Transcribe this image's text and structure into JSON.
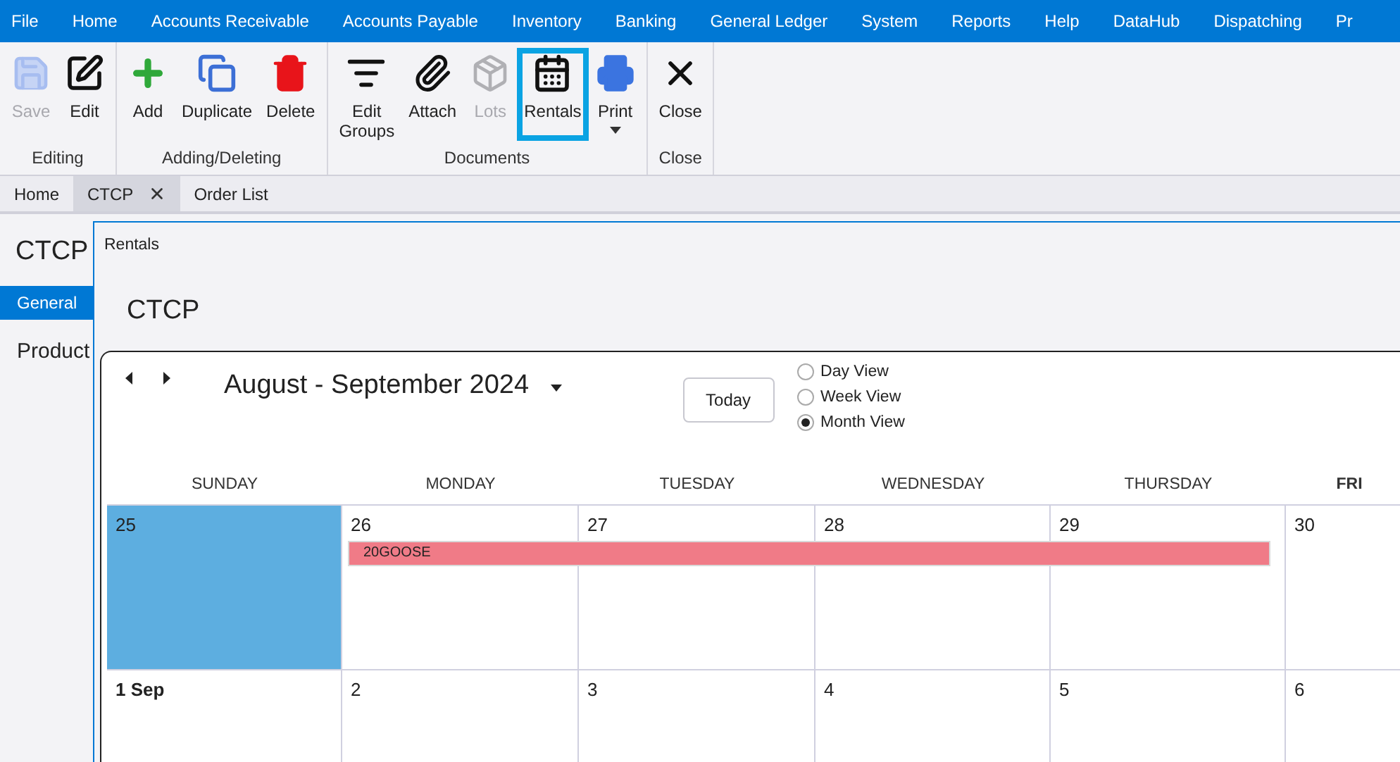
{
  "menu_bar": {
    "items": [
      "File",
      "Home",
      "Accounts Receivable",
      "Accounts Payable",
      "Inventory",
      "Banking",
      "General Ledger",
      "System",
      "Reports",
      "Help",
      "DataHub",
      "Dispatching",
      "Pr"
    ]
  },
  "ribbon": {
    "groups": [
      {
        "label": "Editing",
        "buttons": [
          {
            "label": "Save",
            "disabled": true,
            "selected": false,
            "dropdown": false
          },
          {
            "label": "Edit",
            "disabled": false,
            "selected": false,
            "dropdown": false
          }
        ]
      },
      {
        "label": "Adding/Deleting",
        "buttons": [
          {
            "label": "Add",
            "disabled": false,
            "selected": false,
            "dropdown": false
          },
          {
            "label": "Duplicate",
            "disabled": false,
            "selected": false,
            "dropdown": false
          },
          {
            "label": "Delete",
            "disabled": false,
            "selected": false,
            "dropdown": false
          }
        ]
      },
      {
        "label": "Documents",
        "buttons": [
          {
            "label": "Edit\nGroups",
            "disabled": false,
            "selected": false,
            "dropdown": false
          },
          {
            "label": "Attach",
            "disabled": false,
            "selected": false,
            "dropdown": false
          },
          {
            "label": "Lots",
            "disabled": true,
            "selected": false,
            "dropdown": false
          },
          {
            "label": "Rentals",
            "disabled": false,
            "selected": true,
            "dropdown": false
          },
          {
            "label": "Print",
            "disabled": false,
            "selected": false,
            "dropdown": true
          }
        ]
      },
      {
        "label": "Close",
        "buttons": [
          {
            "label": "Close",
            "disabled": false,
            "selected": false,
            "dropdown": false
          }
        ]
      }
    ]
  },
  "document_tabs": [
    {
      "label": "Home",
      "selected": false,
      "closable": false
    },
    {
      "label": "CTCP",
      "selected": true,
      "closable": true
    },
    {
      "label": "Order List",
      "selected": false,
      "closable": false
    }
  ],
  "side_panel": {
    "title": "CTCP",
    "items": [
      {
        "label": "General",
        "selected": true
      },
      {
        "label": "Product",
        "selected": false
      }
    ]
  },
  "rentals_dialog": {
    "title": "Rentals",
    "heading": "CTCP",
    "calendar": {
      "range_title": "August - September 2024",
      "today_button": "Today",
      "views": [
        {
          "label": "Day View",
          "selected": false
        },
        {
          "label": "Week View",
          "selected": false
        },
        {
          "label": "Month View",
          "selected": true
        }
      ],
      "day_headers": [
        {
          "label": "SUNDAY",
          "bold": false
        },
        {
          "label": "MONDAY",
          "bold": false
        },
        {
          "label": "TUESDAY",
          "bold": false
        },
        {
          "label": "WEDNESDAY",
          "bold": false
        },
        {
          "label": "THURSDAY",
          "bold": false
        },
        {
          "label": "FRI",
          "bold": true
        }
      ],
      "weeks": [
        {
          "days": [
            {
              "label": "25",
              "selected": true,
              "bold": false,
              "in_event": false
            },
            {
              "label": "26",
              "selected": false,
              "bold": false,
              "in_event": true
            },
            {
              "label": "27",
              "selected": false,
              "bold": false,
              "in_event": true
            },
            {
              "label": "28",
              "selected": false,
              "bold": false,
              "in_event": true
            },
            {
              "label": "29",
              "selected": false,
              "bold": false,
              "in_event": true
            },
            {
              "label": "30",
              "selected": false,
              "bold": false,
              "in_event": false
            }
          ],
          "event": {
            "title": "20GOOSE",
            "color": "#f07b87"
          }
        },
        {
          "days": [
            {
              "label": "1 Sep",
              "selected": false,
              "bold": true
            },
            {
              "label": "2",
              "selected": false,
              "bold": false
            },
            {
              "label": "3",
              "selected": false,
              "bold": false
            },
            {
              "label": "4",
              "selected": false,
              "bold": false
            },
            {
              "label": "5",
              "selected": false,
              "bold": false
            },
            {
              "label": "6",
              "selected": false,
              "bold": false
            }
          ]
        }
      ]
    }
  }
}
